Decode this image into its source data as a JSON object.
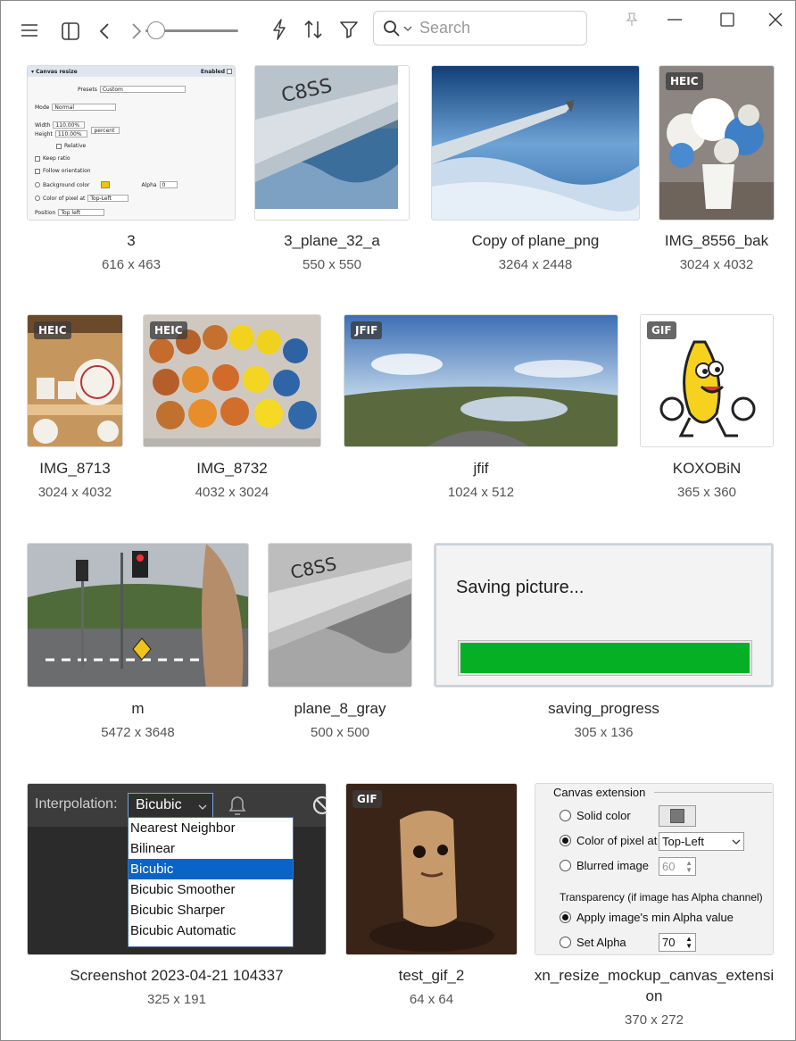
{
  "toolbar": {
    "search_placeholder": "Search"
  },
  "items": [
    {
      "name": "3",
      "dims": "616 x 463",
      "badge": ""
    },
    {
      "name": "3_plane_32_a",
      "dims": "550 x 550",
      "badge": ""
    },
    {
      "name": "Copy of plane_png",
      "dims": "3264 x 2448",
      "badge": ""
    },
    {
      "name": "IMG_8556_bak",
      "dims": "3024 x 4032",
      "badge": "HEIC"
    },
    {
      "name": "IMG_8713",
      "dims": "3024 x 4032",
      "badge": "HEIC"
    },
    {
      "name": "IMG_8732",
      "dims": "4032 x 3024",
      "badge": "HEIC"
    },
    {
      "name": "jfif",
      "dims": "1024 x 512",
      "badge": "JFIF"
    },
    {
      "name": "KOXOBiN",
      "dims": "365 x 360",
      "badge": "GIF"
    },
    {
      "name": "m",
      "dims": "5472 x 3648",
      "badge": ""
    },
    {
      "name": "plane_8_gray",
      "dims": "500 x 500",
      "badge": ""
    },
    {
      "name": "saving_progress",
      "dims": "305 x 136",
      "badge": ""
    },
    {
      "name": "Screenshot 2023-04-21 104337",
      "dims": "325 x 191",
      "badge": ""
    },
    {
      "name": "test_gif_2",
      "dims": "64 x 64",
      "badge": "GIF"
    },
    {
      "name": "xn_resize_mockup_canvas_extensi",
      "name2": "on",
      "dims": "370 x 272",
      "badge": ""
    }
  ],
  "thumb_canvas_resize": {
    "title": "Canvas resize",
    "enabled": "Enabled",
    "presets_label": "Presets",
    "presets_value": "Custom",
    "mode_label": "Mode",
    "mode_value": "Normal",
    "width_label": "Width",
    "width_value": "110.00%",
    "height_label": "Height",
    "height_value": "110.00%",
    "unit_value": "percent",
    "relative": "Relative",
    "keep_ratio": "Keep ratio",
    "follow_orientation": "Follow orientation",
    "background_color": "Background color",
    "alpha_label": "Alpha",
    "alpha_value": "0",
    "color_of_pixel": "Color of pixel at",
    "pixel_value": "Top-Left",
    "position_label": "Position",
    "position_value": "Top left"
  },
  "thumb_saving": {
    "title": "Saving picture...",
    "progress": 1.0
  },
  "thumb_interpolation": {
    "label": "Interpolation:",
    "selected": "Bicubic",
    "options": [
      "Nearest Neighbor",
      "Bilinear",
      "Bicubic",
      "Bicubic Smoother",
      "Bicubic Sharper",
      "Bicubic Automatic"
    ]
  },
  "thumb_canvas_extension": {
    "group": "Canvas extension",
    "solid_color": "Solid color",
    "color_of_pixel": "Color of pixel at",
    "pixel_value": "Top-Left",
    "blurred_image": "Blurred image",
    "blur_value": "60",
    "transparency": "Transparency (if image has Alpha channel)",
    "apply_min_alpha": "Apply image's min Alpha value",
    "set_alpha": "Set Alpha",
    "alpha_value": "70"
  },
  "colors": {
    "progress_green": "#06b025",
    "selection_blue": "#0a64c8"
  }
}
